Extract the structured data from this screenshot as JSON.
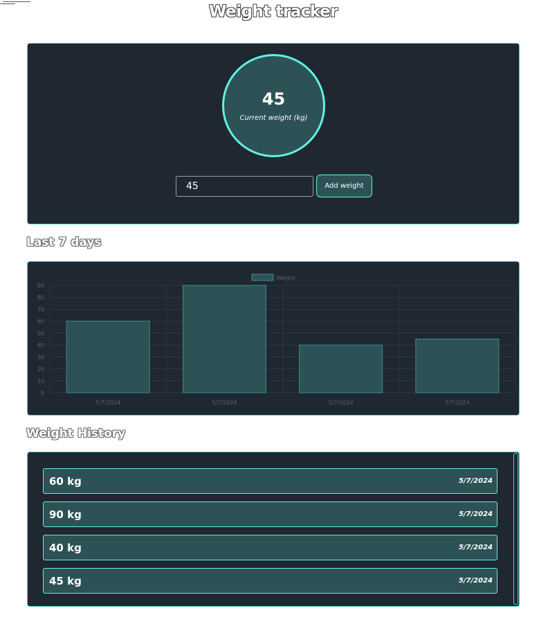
{
  "app": {
    "title": "Weight tracker"
  },
  "current": {
    "value": "45",
    "label": "Current weight (kg)"
  },
  "form": {
    "input_value": "45",
    "add_label": "Add weight"
  },
  "sections": {
    "last7": "Last 7 days",
    "history": "Weight History"
  },
  "colors": {
    "card_bg": "#1f2731",
    "accent": "#62f2e3",
    "bar_fill": "#2d5256"
  },
  "chart_data": {
    "type": "bar",
    "categories": [
      "5/7/2024",
      "5/7/2024",
      "5/7/2024",
      "5/7/2024"
    ],
    "series": [
      {
        "name": "Weight",
        "values": [
          60,
          90,
          40,
          45
        ]
      }
    ],
    "yticks": [
      0,
      10,
      20,
      30,
      40,
      50,
      60,
      70,
      80,
      90
    ],
    "ylim": [
      0,
      90
    ],
    "legend": "top-center",
    "grid": true
  },
  "history": [
    {
      "weight": "60 kg",
      "date": "5/7/2024"
    },
    {
      "weight": "90 kg",
      "date": "5/7/2024"
    },
    {
      "weight": "40 kg",
      "date": "5/7/2024"
    },
    {
      "weight": "45 kg",
      "date": "5/7/2024"
    }
  ]
}
